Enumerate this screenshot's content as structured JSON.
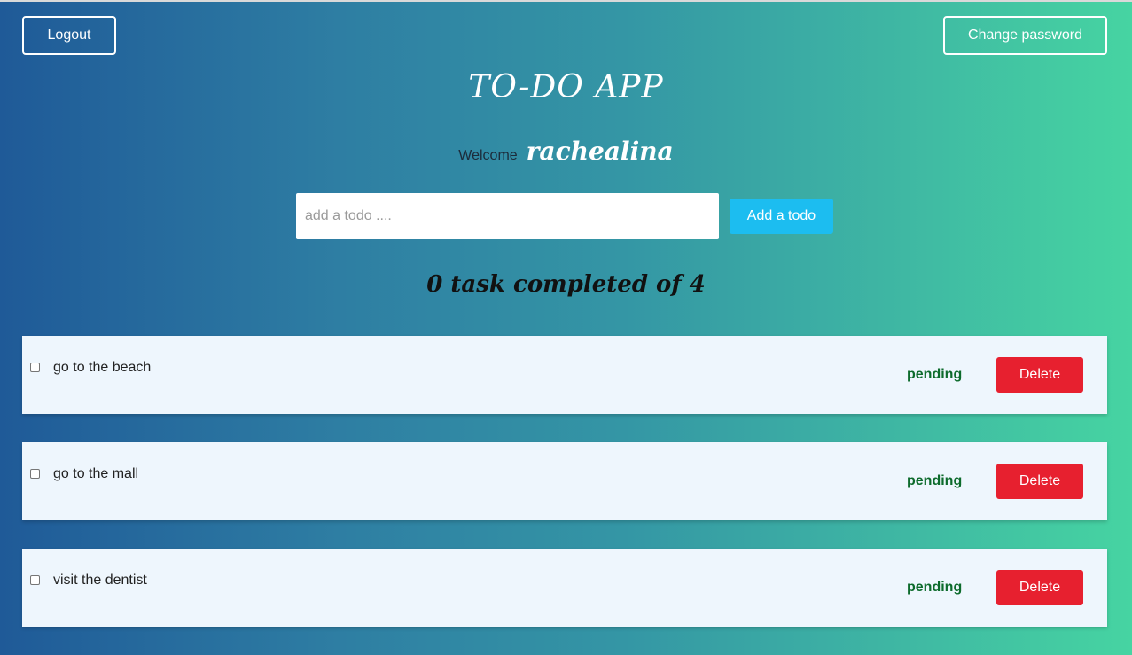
{
  "header": {
    "logout_label": "Logout",
    "change_password_label": "Change password"
  },
  "app": {
    "title": "TO-DO APP",
    "welcome_label": "Welcome",
    "username": "rachealina"
  },
  "add_form": {
    "placeholder": "add a todo ....",
    "value": "",
    "button_label": "Add a todo"
  },
  "progress": {
    "text": "0 task completed of 4",
    "completed": 0,
    "total": 4
  },
  "todos": [
    {
      "text": "go to the beach",
      "status": "pending",
      "checked": false,
      "delete_label": "Delete"
    },
    {
      "text": "go to the mall",
      "status": "pending",
      "checked": false,
      "delete_label": "Delete"
    },
    {
      "text": "visit the dentist",
      "status": "pending",
      "checked": false,
      "delete_label": "Delete"
    }
  ],
  "colors": {
    "gradient_start": "#1f5a98",
    "gradient_end": "#46d4a2",
    "add_button": "#1cbdf0",
    "delete_button": "#e7202f",
    "pending_status": "#0d6b2c",
    "item_background": "#eef6fd"
  }
}
